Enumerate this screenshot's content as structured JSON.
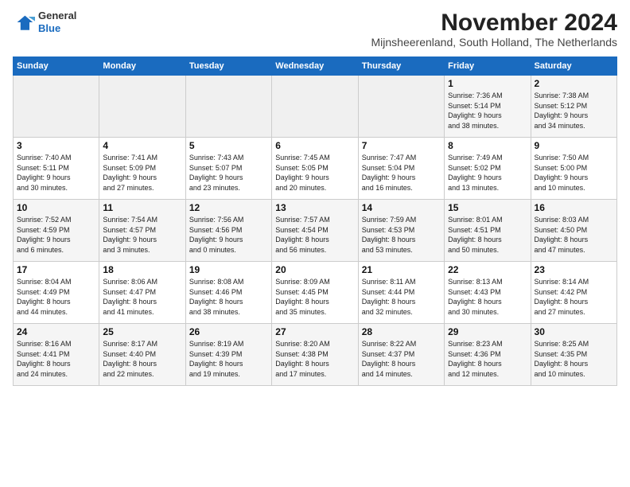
{
  "logo": {
    "line1": "General",
    "line2": "Blue"
  },
  "title": "November 2024",
  "subtitle": "Mijnsheerenland, South Holland, The Netherlands",
  "weekdays": [
    "Sunday",
    "Monday",
    "Tuesday",
    "Wednesday",
    "Thursday",
    "Friday",
    "Saturday"
  ],
  "weeks": [
    [
      {
        "day": "",
        "info": ""
      },
      {
        "day": "",
        "info": ""
      },
      {
        "day": "",
        "info": ""
      },
      {
        "day": "",
        "info": ""
      },
      {
        "day": "",
        "info": ""
      },
      {
        "day": "1",
        "info": "Sunrise: 7:36 AM\nSunset: 5:14 PM\nDaylight: 9 hours\nand 38 minutes."
      },
      {
        "day": "2",
        "info": "Sunrise: 7:38 AM\nSunset: 5:12 PM\nDaylight: 9 hours\nand 34 minutes."
      }
    ],
    [
      {
        "day": "3",
        "info": "Sunrise: 7:40 AM\nSunset: 5:11 PM\nDaylight: 9 hours\nand 30 minutes."
      },
      {
        "day": "4",
        "info": "Sunrise: 7:41 AM\nSunset: 5:09 PM\nDaylight: 9 hours\nand 27 minutes."
      },
      {
        "day": "5",
        "info": "Sunrise: 7:43 AM\nSunset: 5:07 PM\nDaylight: 9 hours\nand 23 minutes."
      },
      {
        "day": "6",
        "info": "Sunrise: 7:45 AM\nSunset: 5:05 PM\nDaylight: 9 hours\nand 20 minutes."
      },
      {
        "day": "7",
        "info": "Sunrise: 7:47 AM\nSunset: 5:04 PM\nDaylight: 9 hours\nand 16 minutes."
      },
      {
        "day": "8",
        "info": "Sunrise: 7:49 AM\nSunset: 5:02 PM\nDaylight: 9 hours\nand 13 minutes."
      },
      {
        "day": "9",
        "info": "Sunrise: 7:50 AM\nSunset: 5:00 PM\nDaylight: 9 hours\nand 10 minutes."
      }
    ],
    [
      {
        "day": "10",
        "info": "Sunrise: 7:52 AM\nSunset: 4:59 PM\nDaylight: 9 hours\nand 6 minutes."
      },
      {
        "day": "11",
        "info": "Sunrise: 7:54 AM\nSunset: 4:57 PM\nDaylight: 9 hours\nand 3 minutes."
      },
      {
        "day": "12",
        "info": "Sunrise: 7:56 AM\nSunset: 4:56 PM\nDaylight: 9 hours\nand 0 minutes."
      },
      {
        "day": "13",
        "info": "Sunrise: 7:57 AM\nSunset: 4:54 PM\nDaylight: 8 hours\nand 56 minutes."
      },
      {
        "day": "14",
        "info": "Sunrise: 7:59 AM\nSunset: 4:53 PM\nDaylight: 8 hours\nand 53 minutes."
      },
      {
        "day": "15",
        "info": "Sunrise: 8:01 AM\nSunset: 4:51 PM\nDaylight: 8 hours\nand 50 minutes."
      },
      {
        "day": "16",
        "info": "Sunrise: 8:03 AM\nSunset: 4:50 PM\nDaylight: 8 hours\nand 47 minutes."
      }
    ],
    [
      {
        "day": "17",
        "info": "Sunrise: 8:04 AM\nSunset: 4:49 PM\nDaylight: 8 hours\nand 44 minutes."
      },
      {
        "day": "18",
        "info": "Sunrise: 8:06 AM\nSunset: 4:47 PM\nDaylight: 8 hours\nand 41 minutes."
      },
      {
        "day": "19",
        "info": "Sunrise: 8:08 AM\nSunset: 4:46 PM\nDaylight: 8 hours\nand 38 minutes."
      },
      {
        "day": "20",
        "info": "Sunrise: 8:09 AM\nSunset: 4:45 PM\nDaylight: 8 hours\nand 35 minutes."
      },
      {
        "day": "21",
        "info": "Sunrise: 8:11 AM\nSunset: 4:44 PM\nDaylight: 8 hours\nand 32 minutes."
      },
      {
        "day": "22",
        "info": "Sunrise: 8:13 AM\nSunset: 4:43 PM\nDaylight: 8 hours\nand 30 minutes."
      },
      {
        "day": "23",
        "info": "Sunrise: 8:14 AM\nSunset: 4:42 PM\nDaylight: 8 hours\nand 27 minutes."
      }
    ],
    [
      {
        "day": "24",
        "info": "Sunrise: 8:16 AM\nSunset: 4:41 PM\nDaylight: 8 hours\nand 24 minutes."
      },
      {
        "day": "25",
        "info": "Sunrise: 8:17 AM\nSunset: 4:40 PM\nDaylight: 8 hours\nand 22 minutes."
      },
      {
        "day": "26",
        "info": "Sunrise: 8:19 AM\nSunset: 4:39 PM\nDaylight: 8 hours\nand 19 minutes."
      },
      {
        "day": "27",
        "info": "Sunrise: 8:20 AM\nSunset: 4:38 PM\nDaylight: 8 hours\nand 17 minutes."
      },
      {
        "day": "28",
        "info": "Sunrise: 8:22 AM\nSunset: 4:37 PM\nDaylight: 8 hours\nand 14 minutes."
      },
      {
        "day": "29",
        "info": "Sunrise: 8:23 AM\nSunset: 4:36 PM\nDaylight: 8 hours\nand 12 minutes."
      },
      {
        "day": "30",
        "info": "Sunrise: 8:25 AM\nSunset: 4:35 PM\nDaylight: 8 hours\nand 10 minutes."
      }
    ]
  ]
}
